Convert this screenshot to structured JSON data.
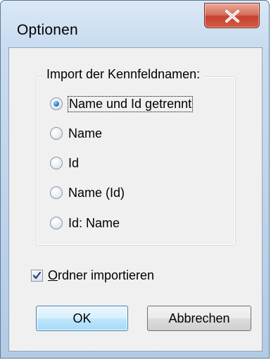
{
  "window": {
    "title": "Optionen"
  },
  "group": {
    "legend": "Import der Kennfeldnamen:",
    "options": [
      {
        "label": "Name und Id getrennt",
        "checked": true
      },
      {
        "label": "Name",
        "checked": false
      },
      {
        "label": "Id",
        "checked": false
      },
      {
        "label": "Name (Id)",
        "checked": false
      },
      {
        "label": "Id: Name",
        "checked": false
      }
    ]
  },
  "checkbox": {
    "mnemonic": "O",
    "rest": "rdner importieren",
    "checked": true
  },
  "buttons": {
    "ok": "OK",
    "cancel": "Abbrechen"
  },
  "icons": {
    "close": "close-x-icon",
    "radio_selected": "radio-selected-icon",
    "checkmark": "checkmark-icon"
  },
  "colors": {
    "close_button": "#c24331",
    "dialog_bg": "#f0f0f0",
    "frame": "#bed3ea",
    "default_button": "#bee6fd"
  }
}
